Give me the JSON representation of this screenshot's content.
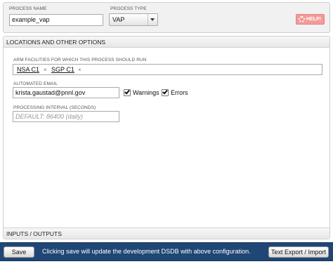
{
  "process": {
    "name_label": "PROCESS NAME",
    "name_value": "example_vap",
    "type_label": "PROCESS TYPE",
    "type_value": "VAP",
    "help_label": "HELP!"
  },
  "locations": {
    "header": "LOCATIONS AND OTHER OPTIONS",
    "facilities_label": "ARM FACILITIES FOR WHICH THIS PROCESS SHOULD RUN",
    "facilities": [
      {
        "label": "NSA C1",
        "remove": "×"
      },
      {
        "label": "SGP C1",
        "remove": "×"
      }
    ],
    "email_label": "AUTOMATED EMAIL",
    "email_value": "krista.gaustad@pnnl.gov",
    "warnings": {
      "label": "Warnings",
      "checked": true
    },
    "errors": {
      "label": "Errors",
      "checked": true
    },
    "interval_label": "PROCESSING INTERVAL (SECONDS)",
    "interval_placeholder": "DEFAULT: 86400 (daily)"
  },
  "io": {
    "header": "INPUTS / OUTPUTS"
  },
  "footer": {
    "save_label": "Save",
    "message": "Clicking save will update the development DSDB with above configuration.",
    "export_label": "Text Export / Import"
  },
  "colors": {
    "footer_bg": "#1f4675",
    "help_bg": "#f39a9a"
  }
}
